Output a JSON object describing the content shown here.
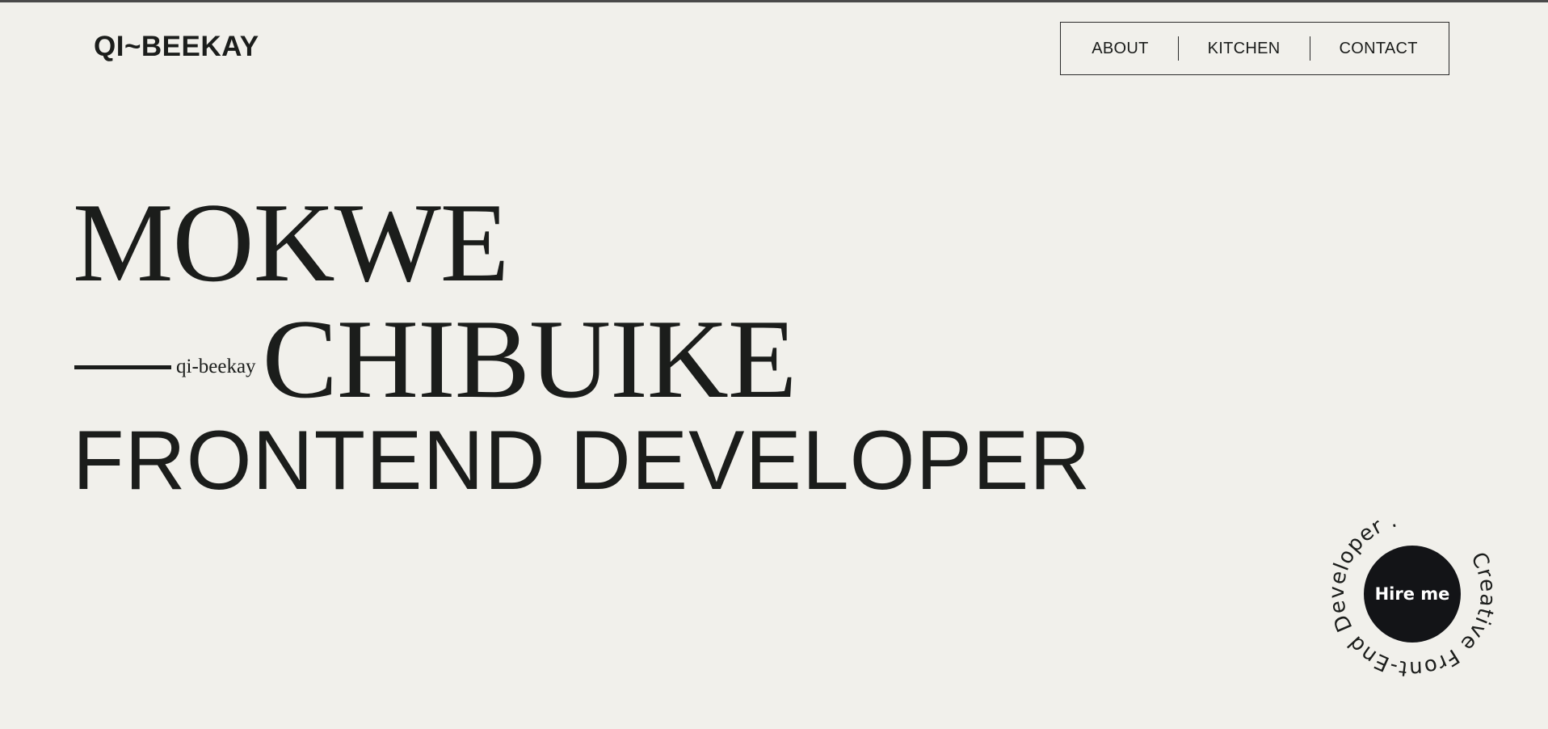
{
  "header": {
    "logo": "QI~BEEKAY"
  },
  "nav": {
    "items": [
      {
        "label": "ABOUT"
      },
      {
        "label": "KITCHEN"
      },
      {
        "label": "CONTACT"
      }
    ]
  },
  "hero": {
    "first_name": "MOKWE",
    "handle": "qi-beekay",
    "last_name": "CHIBUIKE",
    "role": "FRONTEND DEVELOPER"
  },
  "hire": {
    "button_label": "Hire me",
    "ring_text": "Creative Front-End Developer ."
  },
  "colors": {
    "background": "#f1f0eb",
    "text": "#1b1d1b",
    "button": "#131417",
    "button_text": "#ffffff"
  }
}
